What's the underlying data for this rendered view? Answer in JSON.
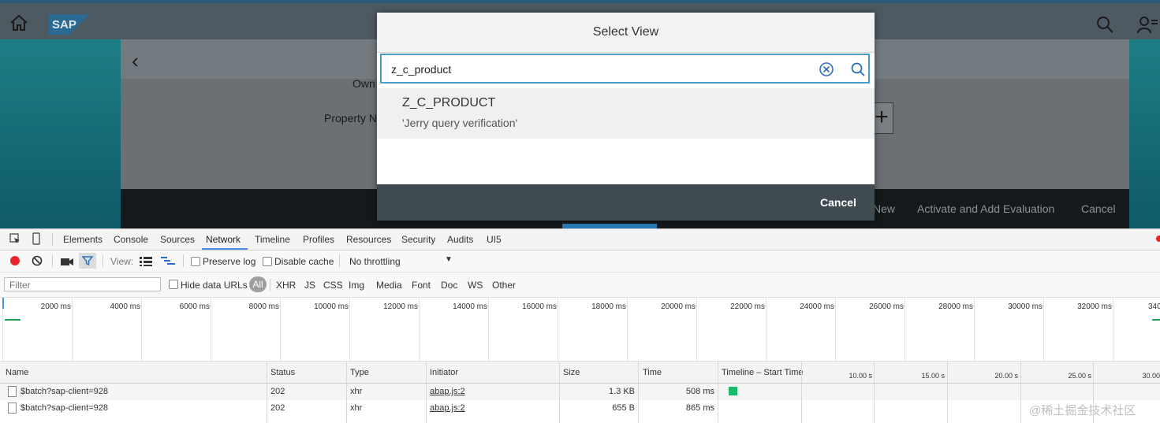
{
  "app": {
    "logo": "SAP",
    "own_label": "Own",
    "property_label": "Property N",
    "footer_buttons": [
      "New",
      "Activate and Add Evaluation",
      "Cancel"
    ]
  },
  "dialog": {
    "title": "Select View",
    "search_value": "z_c_product",
    "result_title": "Z_C_PRODUCT",
    "result_description": "'Jerry query verification'",
    "cancel_label": "Cancel"
  },
  "devtools": {
    "tabs": [
      "Elements",
      "Console",
      "Sources",
      "Network",
      "Timeline",
      "Profiles",
      "Resources",
      "Security",
      "Audits",
      "UI5"
    ],
    "active_tab": "Network",
    "view_label": "View:",
    "preserve_log_label": "Preserve log",
    "disable_cache_label": "Disable cache",
    "throttling_value": "No throttling",
    "filter_placeholder": "Filter",
    "hide_data_urls_label": "Hide data URLs",
    "filter_types": [
      "All",
      "XHR",
      "JS",
      "CSS",
      "Img",
      "Media",
      "Font",
      "Doc",
      "WS",
      "Other"
    ],
    "overview_ticks": [
      "2000 ms",
      "4000 ms",
      "6000 ms",
      "8000 ms",
      "10000 ms",
      "12000 ms",
      "14000 ms",
      "16000 ms",
      "18000 ms",
      "20000 ms",
      "22000 ms",
      "24000 ms",
      "26000 ms",
      "28000 ms",
      "30000 ms",
      "32000 ms",
      "340"
    ],
    "columns": [
      "Name",
      "Status",
      "Type",
      "Initiator",
      "Size",
      "Time",
      "Timeline – Start Time"
    ],
    "waterfall_ticks": [
      "10.00 s",
      "15.00 s",
      "20.00 s",
      "25.00 s",
      "30.00"
    ],
    "rows": [
      {
        "name": "$batch?sap-client=928",
        "status": "202",
        "type": "xhr",
        "initiator": "abap.js:2",
        "size": "1.3 KB",
        "time": "508 ms"
      },
      {
        "name": "$batch?sap-client=928",
        "status": "202",
        "type": "xhr",
        "initiator": "abap.js:2",
        "size": "655 B",
        "time": "865 ms"
      }
    ]
  },
  "watermark": "@稀土掘金技术社区",
  "colors": {
    "dialog_border_accent": "#4a9dc9",
    "dialog_footer": "#3f4a51",
    "record_red": "#e8262a",
    "devtools_active_tab": "#4a8ee6",
    "waterfall_green": "#1ab86a"
  }
}
